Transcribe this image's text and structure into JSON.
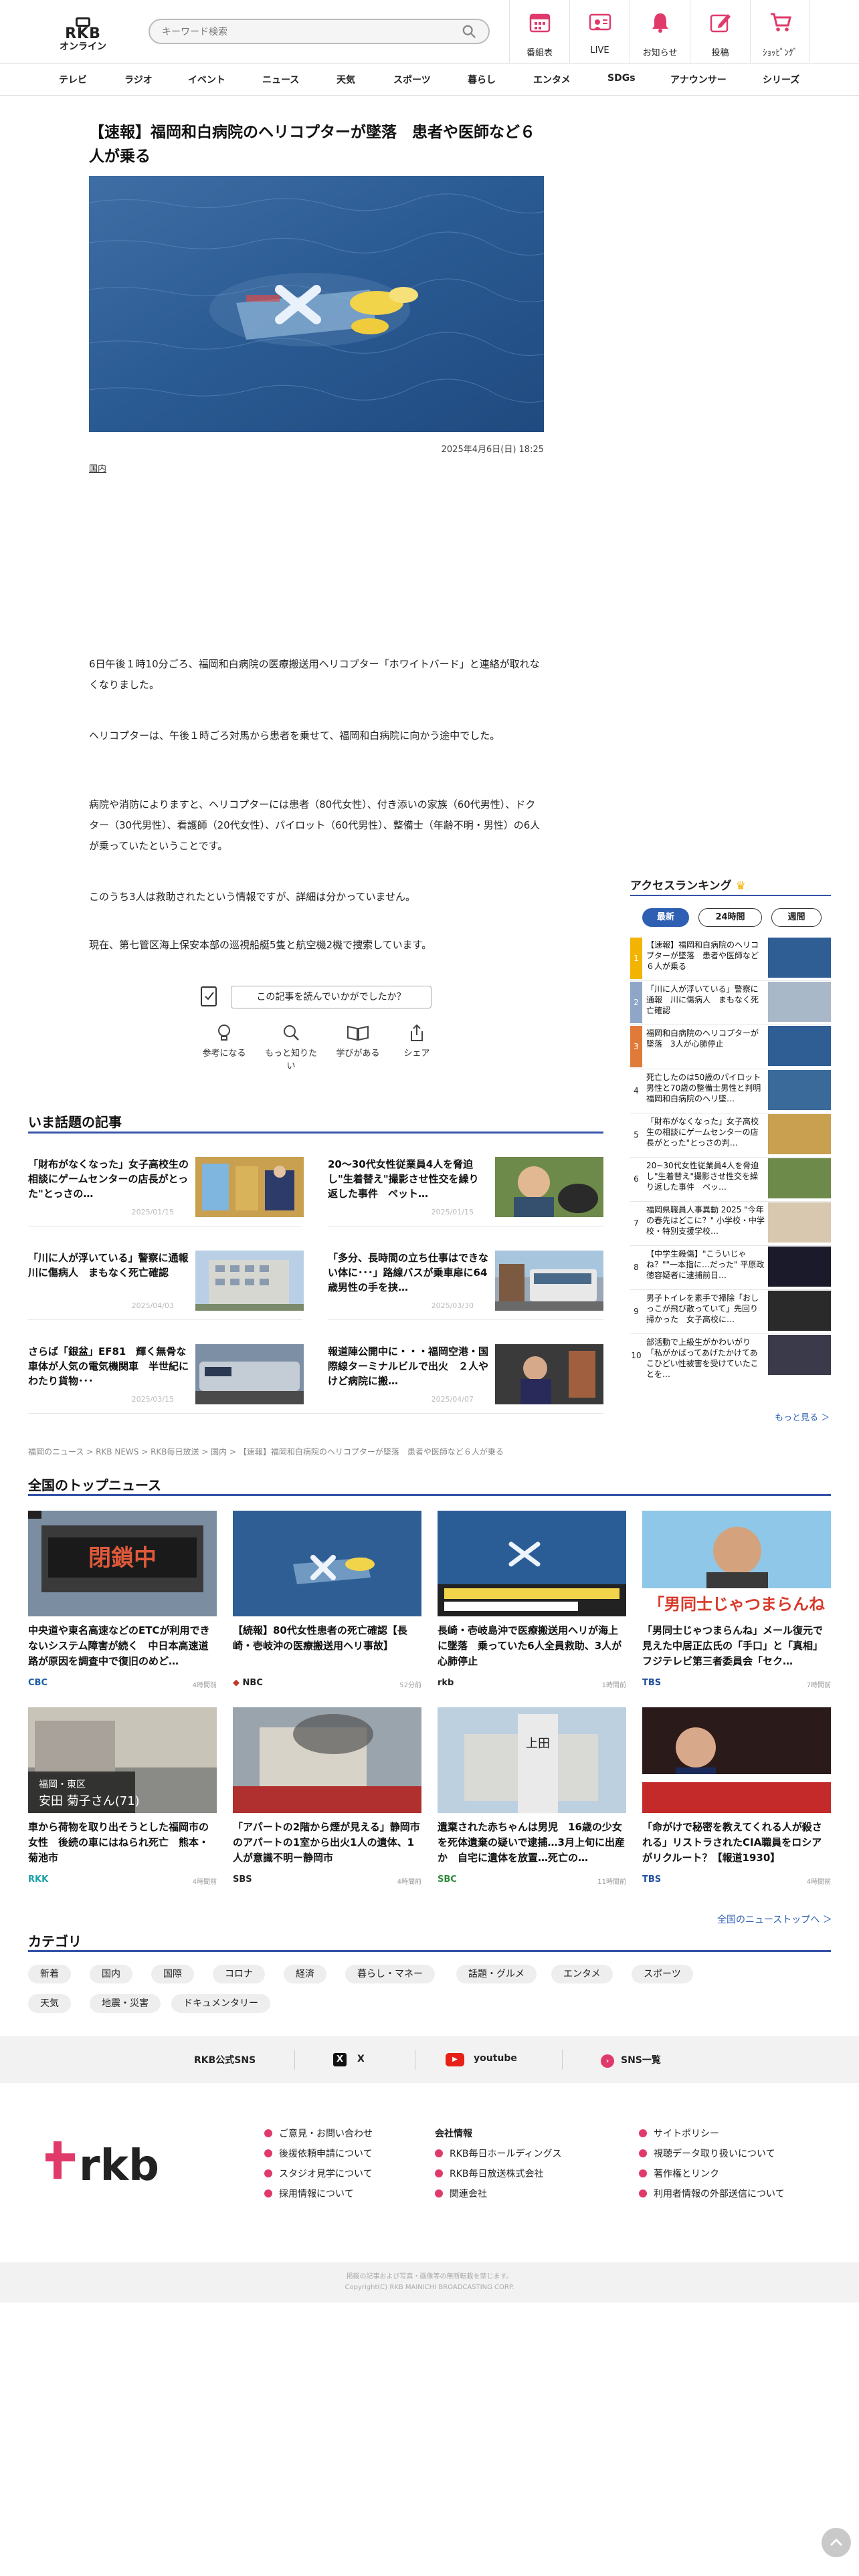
{
  "header": {
    "logo_line1": "RKB",
    "logo_line2": "オンライン",
    "search_placeholder": "キーワード検索",
    "buttons": [
      {
        "label": "番組表",
        "icon": "calendar-icon"
      },
      {
        "label": "LIVE",
        "icon": "live-icon"
      },
      {
        "label": "お知らせ",
        "icon": "bell-icon"
      },
      {
        "label": "投稿",
        "icon": "pencil-icon"
      },
      {
        "label": "ｼｮｯﾋﾟﾝｸﾞ",
        "icon": "cart-icon"
      }
    ]
  },
  "nav": [
    "テレビ",
    "ラジオ",
    "イベント",
    "ニュース",
    "天気",
    "スポーツ",
    "暮らし",
    "エンタメ",
    "SDGs",
    "アナウンサー",
    "シリーズ"
  ],
  "article": {
    "title": "【速報】福岡和白病院のヘリコプターが墜落　患者や医師など６人が乗る",
    "date": "2025年4月6日(日) 18:25",
    "category": "国内",
    "paragraphs": [
      "6日午後１時10分ごろ、福岡和白病院の医療搬送用ヘリコプター「ホワイトバード」と連絡が取れなくなりました。",
      "ヘリコプターは、午後１時ごろ対馬から患者を乗せて、福岡和白病院に向かう途中でした。",
      "病院や消防によりますと、ヘリコプターには患者（80代女性）、付き添いの家族（60代男性）、ドクター（30代男性）、看護師（20代女性）、パイロット（60代男性）、整備士（年齢不明・男性）の6人が乗っていたということです。",
      "このうち3人は救助されたという情報ですが、詳細は分かっていません。",
      "現在、第七管区海上保安本部の巡視船艇5隻と航空機2機で捜索しています。"
    ],
    "read_question": "この記事を読んでいかがでしたか？",
    "reactions": [
      "参考になる",
      "もっと知りたい",
      "学びがある",
      "シェア"
    ]
  },
  "trending": {
    "heading": "いま話題の記事",
    "items": [
      {
        "title": "「財布がなくなった」女子高校生の相談にゲームセンターの店長がとった\"とっさの…",
        "date": "2025/01/15"
      },
      {
        "title": "20～30代女性従業員4人を脅迫し\"生着替え\"撮影させ性交を繰り返した事件　ペット…",
        "date": "2025/01/15"
      },
      {
        "title": "「川に人が浮いている」警察に通報　川に傷病人　まもなく死亡確認",
        "date": "2025/04/03"
      },
      {
        "title": "「多分、長時間の立ち仕事はできない体に･･･」路線バスが乗車扉に64歳男性の手を挟…",
        "date": "2025/03/30"
      },
      {
        "title": "さらば「銀盆」EF81　輝く無骨な車体が人気の電気機関車　半世紀にわたり貨物･･･",
        "date": "2025/03/15"
      },
      {
        "title": "報道陣公開中に・・・福岡空港・国際線ターミナルビルで出火　２人やけど病院に搬…",
        "date": "2025/04/07"
      }
    ]
  },
  "breadcrumb": "福岡のニュース > RKB NEWS > RKB毎日放送 > 国内 > 【速報】福岡和白病院のヘリコプターが墜落　患者や医師など６人が乗る",
  "topnews": {
    "heading": "全国のトップニュース",
    "items": [
      {
        "title": "中央道や東名高速などのETCが利用できないシステム障害が続く　中日本高速道路が原因を調査中で復旧のめど…",
        "source": "CBC",
        "time": "4時間前",
        "color": "#1b5fa8"
      },
      {
        "title": "【続報】80代女性患者の死亡確認【長崎・壱岐沖の医療搬送用ヘリ事故】",
        "source": "NBC",
        "time": "52分前",
        "color": "#c0392b"
      },
      {
        "title": "長崎・壱岐島沖で医療搬送用ヘリが海上に墜落　乗っていた6人全員救助、3人が心肺停止",
        "source": "rkb",
        "time": "1時間前",
        "color": "#222222"
      },
      {
        "title": "「男同士じゃつまらんね」メール復元で見えた中居正広氏の「手口」と「真相」 フジテレビ第三者委員会「セク…",
        "source": "TBS",
        "time": "7時間前",
        "color": "#1f4f9e"
      },
      {
        "title": "車から荷物を取り出そうとした福岡市の女性　後続の車にはねられ死亡　熊本・菊池市",
        "source": "RKK",
        "time": "4時間前",
        "color": "#1aa0a8"
      },
      {
        "title": "「アパートの2階から煙が見える」静岡市のアパートの1室から出火1人の遺体、1人が意識不明ー静岡市",
        "source": "SBS",
        "time": "4時間前",
        "color": "#222222"
      },
      {
        "title": "遺棄された赤ちゃんは男児　16歳の少女を死体遺棄の疑いで逮捕…3月上旬に出産か　自宅に遺体を放置…死亡の…",
        "source": "SBC",
        "time": "11時間前",
        "color": "#2e8b3d"
      },
      {
        "title": "「命がけで秘密を教えてくれる人が殺される」リストラされたCIA職員をロシアがリクルート？【報道1930】",
        "source": "TBS",
        "time": "4時間前",
        "color": "#1f4f9e"
      }
    ],
    "more": "全国のニューストップへ ＞"
  },
  "categories": {
    "heading": "カテゴリ",
    "items": [
      "新着",
      "国内",
      "国際",
      "コロナ",
      "経済",
      "暮らし・マネー",
      "話題・グルメ",
      "エンタメ",
      "スポーツ",
      "天気",
      "地震・災害",
      "ドキュメンタリー"
    ]
  },
  "sns": {
    "label": "RKB公式SNS",
    "x": "X",
    "youtube": "youtube",
    "list": "SNS一覧"
  },
  "footer": {
    "col1": [
      "ご意見・お問い合わせ",
      "後援依頼申請について",
      "スタジオ見学について",
      "採用情報について"
    ],
    "col2_heading": "会社情報",
    "col2": [
      "RKB毎日ホールディングス",
      "RKB毎日放送株式会社",
      "関連会社"
    ],
    "col3": [
      "サイトポリシー",
      "視聴データ取り扱いについて",
      "著作権とリンク",
      "利用者情報の外部送信について"
    ],
    "copyright1": "掲載の記事および写真・画像等の無断転載を禁じます。",
    "copyright2": "Copyright(C) RKB MAINICHI BROADCASTING CORP."
  },
  "ranking": {
    "heading": "アクセスランキング",
    "tabs": [
      "最新",
      "24時間",
      "週間"
    ],
    "active_tab": "最新",
    "items": [
      {
        "rank": "1",
        "title": "【速報】福岡和白病院のヘリコプターが墜落　患者や医師など６人が乗る",
        "color": "#f2b400"
      },
      {
        "rank": "2",
        "title": "「川に人が浮いている」警察に通報　川に傷病人　まもなく死亡確認",
        "color": "#8fa6c8"
      },
      {
        "rank": "3",
        "title": "福岡和白病院のヘリコプターが墜落　3人が心肺停止",
        "color": "#e07a3a"
      },
      {
        "rank": "4",
        "title": "死亡したのは50歳のパイロット男性と70歳の整備士男性と判明 福岡和白病院のヘリ墜…",
        "color": ""
      },
      {
        "rank": "5",
        "title": "「財布がなくなった」女子高校生の相談にゲームセンターの店長がとった\"とっさの判…",
        "color": ""
      },
      {
        "rank": "6",
        "title": "20~30代女性従業員4人を脅迫し\"生着替え\"撮影させ性交を繰り返した事件　ペッ…",
        "color": ""
      },
      {
        "rank": "7",
        "title": "福岡県職員人事異動 2025 \"今年の春先はどこに？\" 小学校・中学校・特別支援学校…",
        "color": ""
      },
      {
        "rank": "8",
        "title": "【中学生殺傷】\"こういじゃね？\"\"一本指に…だった\" 平原政徳容疑者に逮捕前日…",
        "color": ""
      },
      {
        "rank": "9",
        "title": "男子トイレを素手で掃除「おしっこが飛び散っていて」先回り掃かった　女子高校に…",
        "color": ""
      },
      {
        "rank": "10",
        "title": "部活動で上級生がかわいがり「私がかばってあげたかけてあこひどい性被害を受けていたことを…",
        "color": ""
      }
    ],
    "more": "もっと見る ＞"
  }
}
